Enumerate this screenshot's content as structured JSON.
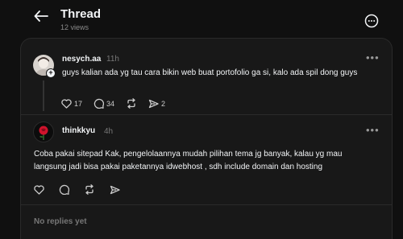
{
  "header": {
    "title": "Thread",
    "views": "12 views"
  },
  "posts": [
    {
      "username": "nesych.aa",
      "time": "11h",
      "text": "guys kalian ada yg tau cara bikin web buat portofolio ga si, kalo ada spil dong guys",
      "likes": "17",
      "comments": "34",
      "shares": "2"
    },
    {
      "username": "thinkkyu",
      "time": "4h",
      "text": "Coba pakai sitepad Kak, pengelolaannya mudah pilihan tema jg banyak, kalau yg mau langsung jadi bisa pakai paketannya idwebhost , sdh include domain dan hosting"
    }
  ],
  "footer": {
    "no_replies": "No replies yet"
  },
  "icons": [
    "back-arrow-icon",
    "more-circle-icon",
    "more-dots-icon",
    "heart-icon",
    "comment-icon",
    "repost-icon",
    "send-icon",
    "plus-icon",
    "rose-icon"
  ],
  "colors": {
    "background": "#101010",
    "panel": "#181818",
    "text": "#f3f5f7",
    "muted": "#777777",
    "rose": "#d0142c"
  }
}
